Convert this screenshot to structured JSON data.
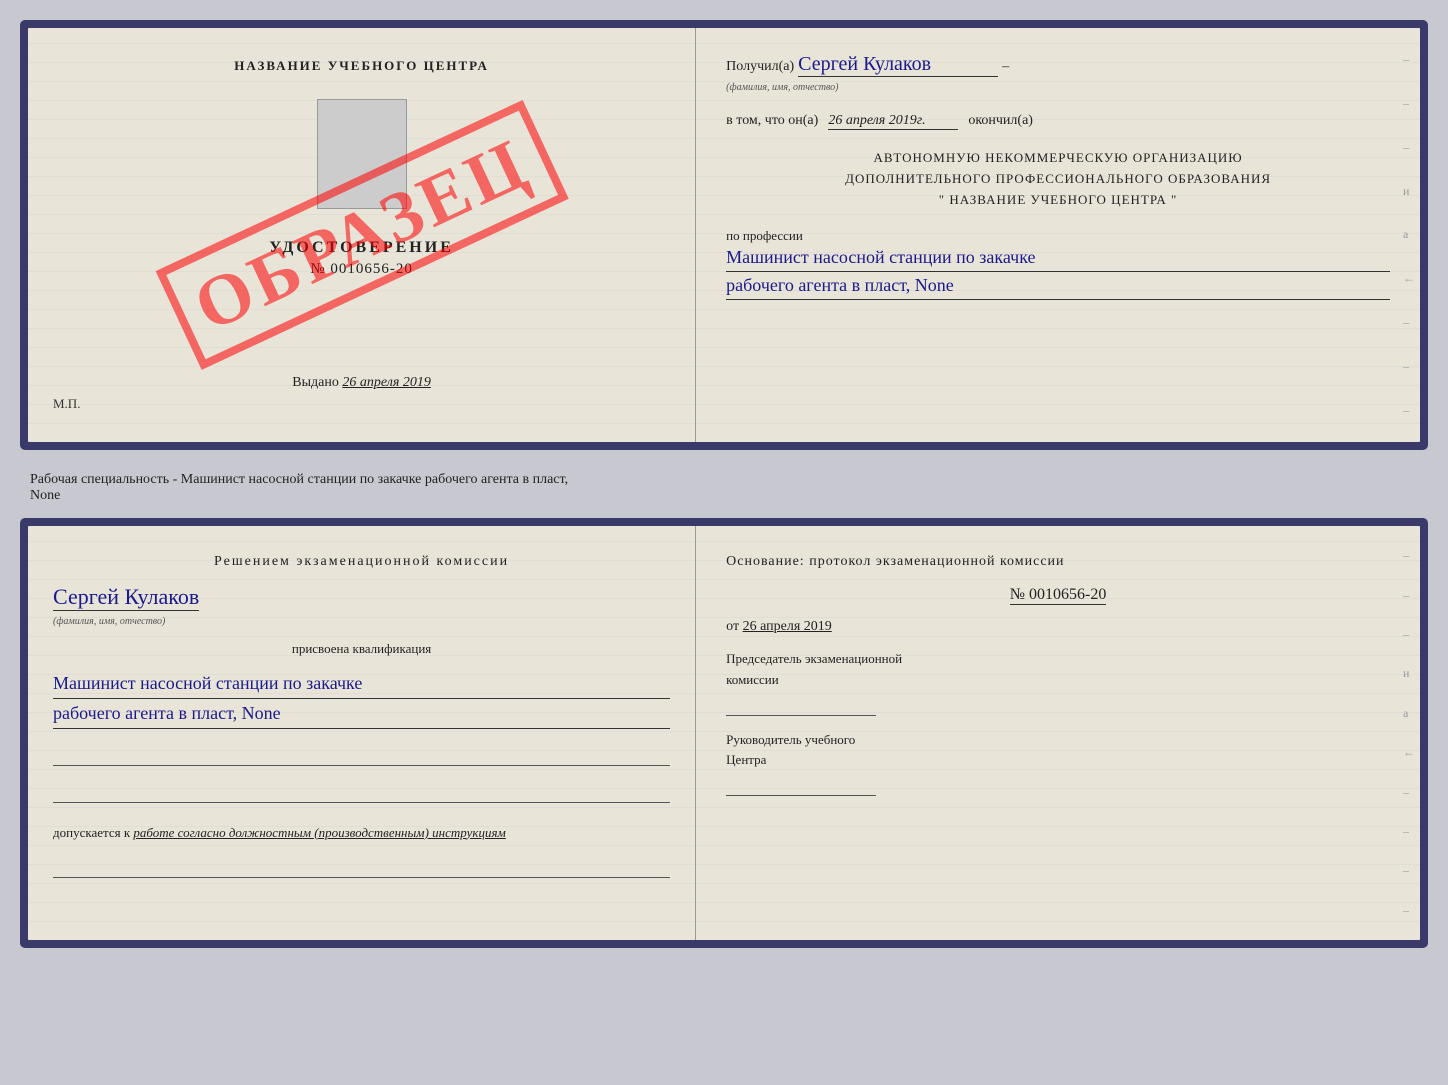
{
  "page": {
    "background_color": "#c8c8d0"
  },
  "top_doc": {
    "left": {
      "title": "НАЗВАНИЕ УЧЕБНОГО ЦЕНТРА",
      "stamp": "ОБРАЗЕЦ",
      "udost_label": "УДОСТОВЕРЕНИЕ",
      "number": "№ 0010656-20",
      "vydano_label": "Выдано",
      "vydano_date": "26 апреля 2019",
      "mp_label": "М.П."
    },
    "right": {
      "received_prefix": "Получил(а)",
      "recipient_name": "Сергей Кулаков",
      "fio_hint": "(фамилия, имя, отчество)",
      "date_prefix": "в том, что он(а)",
      "date_value": "26 апреля 2019г.",
      "okoncil": "окончил(а)",
      "org_line1": "АВТОНОМНУЮ НЕКОММЕРЧЕСКУЮ ОРГАНИЗАЦИЮ",
      "org_line2": "ДОПОЛНИТЕЛЬНОГО ПРОФЕССИОНАЛЬНОГО ОБРАЗОВАНИЯ",
      "org_line3": "\"  НАЗВАНИЕ УЧЕБНОГО ЦЕНТРА  \"",
      "profession_label": "по профессии",
      "profession_line1": "Машинист насосной станции по закачке",
      "profession_line2": "рабочего агента в пласт, None"
    }
  },
  "spec_text": "Рабочая специальность - Машинист насосной станции по закачке рабочего агента в пласт,",
  "spec_text2": "None",
  "bottom_doc": {
    "left": {
      "commission_title": "Решением  экзаменационной  комиссии",
      "person_name": "Сергей Кулаков",
      "fio_hint": "(фамилия, имя, отчество)",
      "prisvoena_label": "присвоена квалификация",
      "qual_line1": "Машинист насосной станции по закачке",
      "qual_line2": "рабочего агента в пласт, None",
      "dopuskaetsya_prefix": "допускается к",
      "dopuskaetsya_text": "работе согласно должностным (производственным) инструкциям"
    },
    "right": {
      "osnov_title": "Основание: протокол экзаменационной комиссии",
      "protocol_number": "№  0010656-20",
      "ot_prefix": "от",
      "ot_date": "26 апреля 2019",
      "chairman_label": "Председатель экзаменационной",
      "chairman_label2": "комиссии",
      "head_label": "Руководитель учебного",
      "head_label2": "Центра"
    }
  },
  "dash_marks": [
    "-",
    "-",
    "-",
    "и",
    "а",
    "←",
    "-",
    "-",
    "-"
  ],
  "dash_marks_bottom": [
    "-",
    "-",
    "-",
    "и",
    "а",
    "←",
    "-",
    "-",
    "-",
    "-"
  ]
}
